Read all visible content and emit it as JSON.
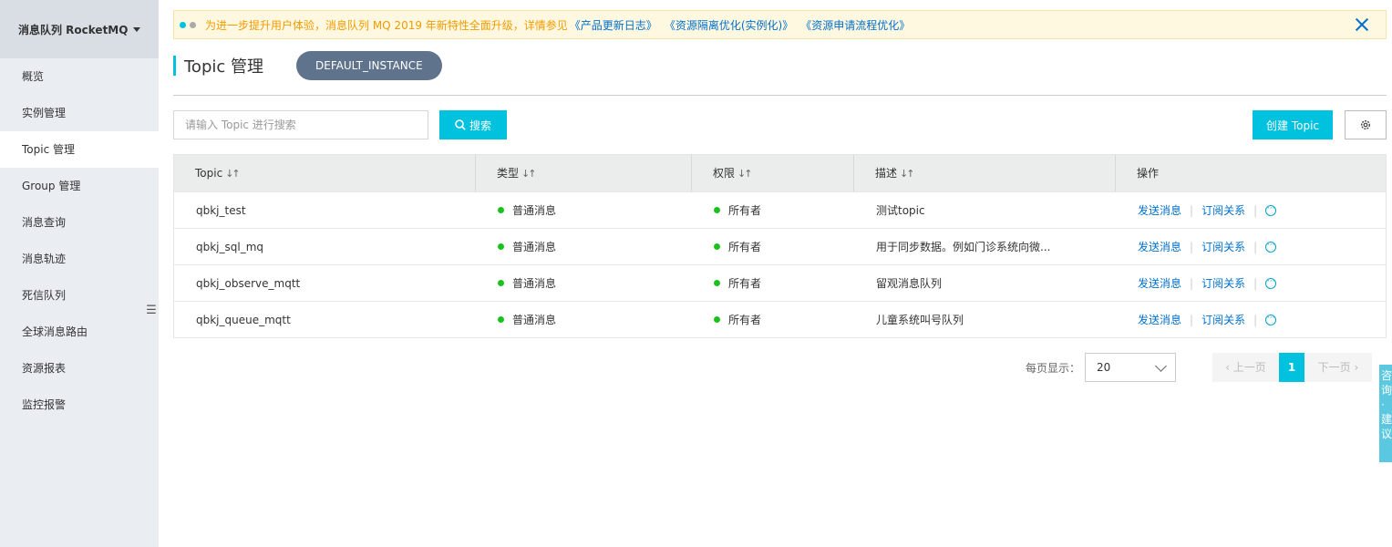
{
  "sidebar": {
    "product": "消息队列 RocketMQ",
    "items": [
      {
        "label": "概览"
      },
      {
        "label": "实例管理"
      },
      {
        "label": "Topic 管理"
      },
      {
        "label": "Group 管理"
      },
      {
        "label": "消息查询"
      },
      {
        "label": "消息轨迹"
      },
      {
        "label": "死信队列"
      },
      {
        "label": "全球消息路由"
      },
      {
        "label": "资源报表"
      },
      {
        "label": "监控报警"
      }
    ],
    "active_index": 2
  },
  "notice": {
    "text": "为进一步提升用户体验，消息队列 MQ 2019 年新特性全面升级，详情参见",
    "links": [
      "《产品更新日志》",
      "《资源隔离优化(实例化)》",
      "《资源申请流程优化》"
    ]
  },
  "header": {
    "title": "Topic 管理",
    "instance": "DEFAULT_INSTANCE"
  },
  "toolbar": {
    "search_placeholder": "请输入 Topic 进行搜索",
    "search_label": "搜索",
    "create_label": "创建 Topic"
  },
  "table": {
    "columns": [
      "Topic",
      "类型",
      "权限",
      "描述",
      "操作"
    ],
    "rows": [
      {
        "topic": "qbkj_test",
        "type": "普通消息",
        "perm": "所有者",
        "desc": "测试topic"
      },
      {
        "topic": "qbkj_sql_mq",
        "type": "普通消息",
        "perm": "所有者",
        "desc": "用于同步数据。例如门诊系统向微..."
      },
      {
        "topic": "qbkj_observe_mqtt",
        "type": "普通消息",
        "perm": "所有者",
        "desc": "留观消息队列"
      },
      {
        "topic": "qbkj_queue_mqtt",
        "type": "普通消息",
        "perm": "所有者",
        "desc": "儿童系统叫号队列"
      }
    ],
    "actions": {
      "send": "发送消息",
      "subscribe": "订阅关系"
    }
  },
  "pagination": {
    "per_page_label": "每页显示：",
    "per_page": "20",
    "prev": "上一页",
    "current": "1",
    "next": "下一页"
  },
  "feedback": {
    "label": "咨询·建议"
  },
  "colors": {
    "accent": "#00c1de",
    "link": "#0070cc",
    "status": "#1dc11d",
    "instance_pill": "#5f738c"
  }
}
